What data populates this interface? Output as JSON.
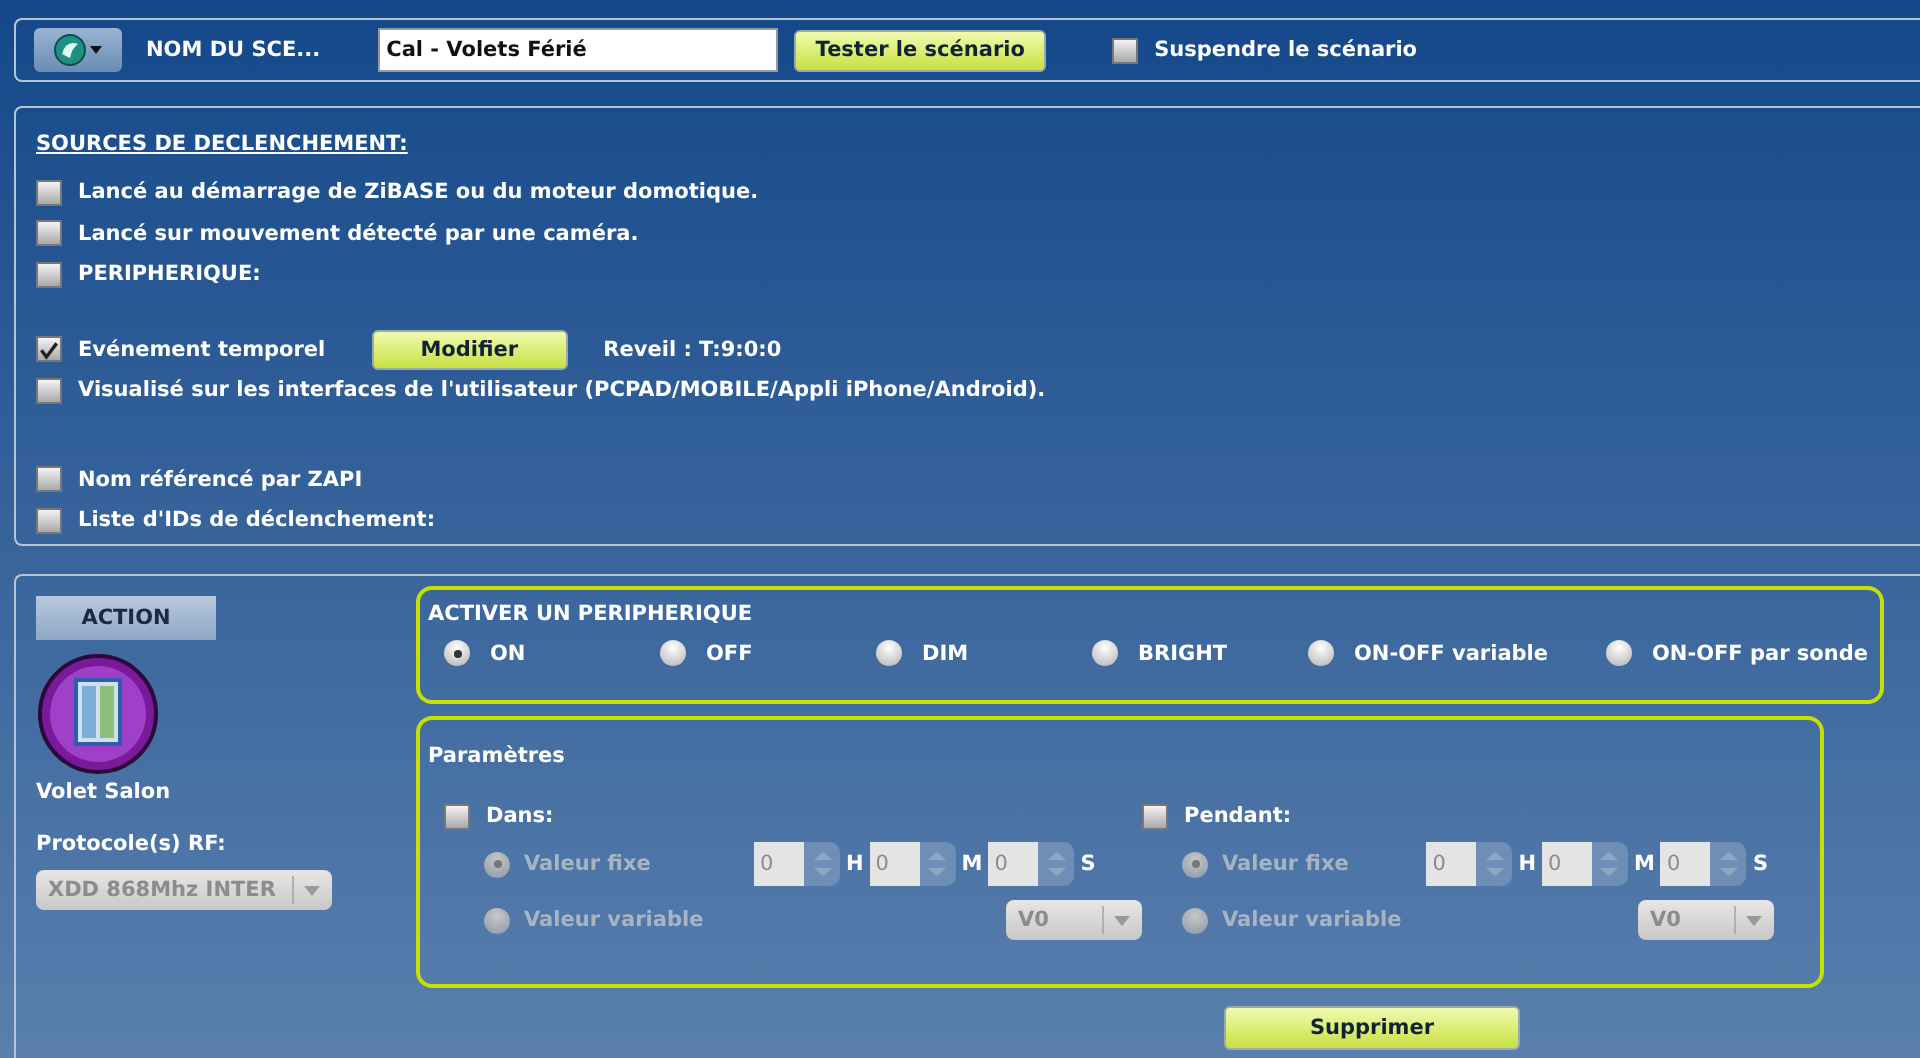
{
  "header": {
    "scenario_label": "NOM DU SCE...",
    "name_value": "Cal - Volets Férié",
    "test_button": "Tester le scénario",
    "suspend": {
      "label": "Suspendre le scénario",
      "checked": false
    }
  },
  "triggers": {
    "title": "SOURCES DE DECLENCHEMENT:",
    "groups": [
      [
        {
          "label": "Lancé au démarrage de ZiBASE ou du moteur domotique.",
          "checked": false
        },
        {
          "label": "Lancé sur mouvement détecté par une caméra.",
          "checked": false
        },
        {
          "label": "PERIPHERIQUE:",
          "checked": false
        }
      ],
      [
        {
          "label": "Evénement temporel",
          "checked": true,
          "button": "Modifier",
          "note": "Reveil : T:9:0:0"
        },
        {
          "label": "Visualisé sur les interfaces de l'utilisateur (PCPAD/MOBILE/Appli iPhone/Android).",
          "checked": false
        }
      ],
      [
        {
          "label": "Nom référencé par ZAPI",
          "checked": false
        },
        {
          "label": "Liste d'IDs de déclenchement:",
          "checked": false
        }
      ]
    ]
  },
  "action": {
    "button": "ACTION",
    "device": "Volet Salon",
    "protocol_label": "Protocole(s) RF:",
    "protocol_value": "XDD 868Mhz INTER",
    "protocol_disabled": true
  },
  "activate": {
    "title": "ACTIVER UN PERIPHERIQUE",
    "options": [
      {
        "label": "ON",
        "selected": true
      },
      {
        "label": "OFF",
        "selected": false
      },
      {
        "label": "DIM",
        "selected": false
      },
      {
        "label": "BRIGHT",
        "selected": false
      },
      {
        "label": "ON-OFF variable",
        "selected": false
      },
      {
        "label": "ON-OFF par sonde",
        "selected": false
      }
    ]
  },
  "params": {
    "title": "Paramètres",
    "sections": [
      {
        "label": "Dans:",
        "checked": false,
        "disabled": true,
        "fixed": {
          "label": "Valeur fixe",
          "selected": true,
          "fields": [
            {
              "value": "0",
              "unit": "H"
            },
            {
              "value": "0",
              "unit": "M"
            },
            {
              "value": "0",
              "unit": "S"
            }
          ]
        },
        "variable": {
          "label": "Valeur variable",
          "selected": false,
          "value": "V0"
        }
      },
      {
        "label": "Pendant:",
        "checked": false,
        "disabled": true,
        "fixed": {
          "label": "Valeur fixe",
          "selected": true,
          "fields": [
            {
              "value": "0",
              "unit": "H"
            },
            {
              "value": "0",
              "unit": "M"
            },
            {
              "value": "0",
              "unit": "S"
            }
          ]
        },
        "variable": {
          "label": "Valeur variable",
          "selected": false,
          "value": "V0"
        }
      }
    ]
  },
  "delete_button": "Supprimer"
}
